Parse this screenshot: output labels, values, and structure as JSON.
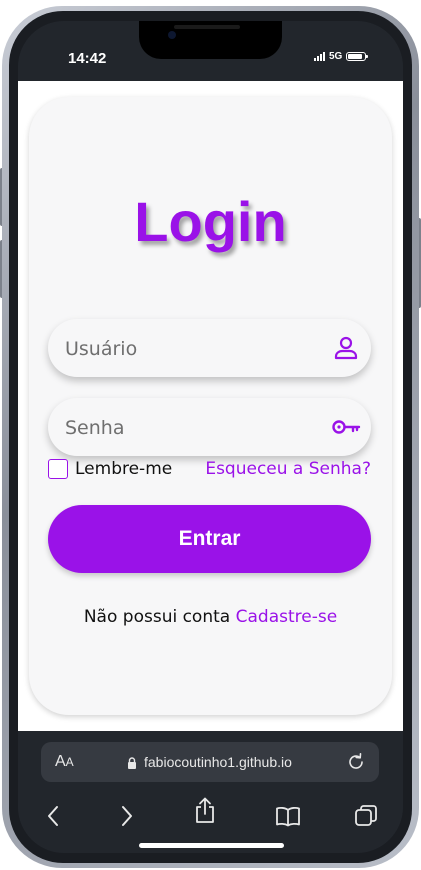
{
  "status_bar": {
    "time": "14:42",
    "network": "5G",
    "signal_bars": 4,
    "battery_level": 0.9
  },
  "login": {
    "title": "Login",
    "username_placeholder": "Usuário",
    "username_value": "",
    "password_placeholder": "Senha",
    "password_value": "",
    "remember_label": "Lembre-me",
    "remember_checked": false,
    "forgot_label": "Esqueceu a Senha?",
    "submit_label": "Entrar",
    "signup_prompt": "Não possui conta",
    "signup_link": "Cadastre-se"
  },
  "browser": {
    "text_size_label_large": "A",
    "text_size_label_small": "A",
    "url": "fabiocoutinho1.github.io",
    "nav_icons": [
      "back-icon",
      "forward-icon",
      "share-icon",
      "bookmarks-icon",
      "tabs-icon"
    ]
  },
  "colors": {
    "accent": "#9a12e8",
    "card_background": "#f7f7f8",
    "browser_chrome": "#22262c"
  }
}
